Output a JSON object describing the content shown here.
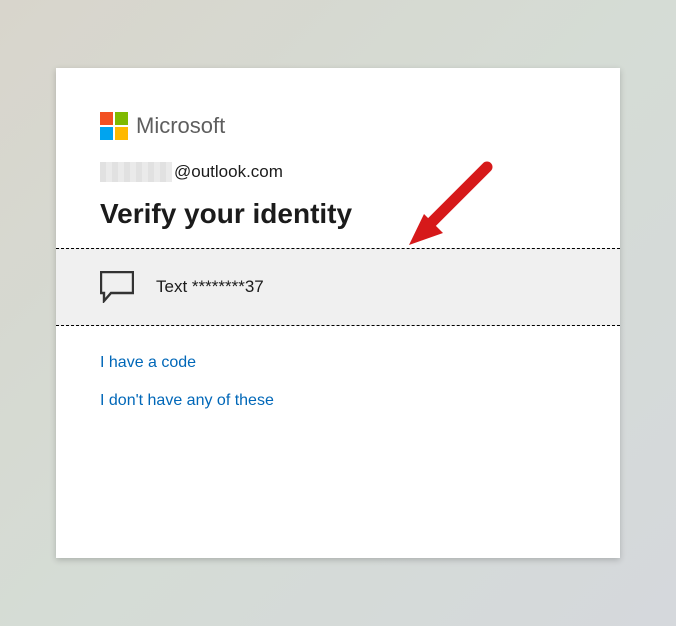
{
  "brand": "Microsoft",
  "account": {
    "username_redacted": true,
    "domain": "@outlook.com"
  },
  "title": "Verify your identity",
  "verification_option": {
    "icon": "text-message-icon",
    "label": "Text ********37"
  },
  "links": {
    "have_code": "I have a code",
    "none_of_these": "I don't have any of these"
  },
  "annotation": {
    "arrow_color": "#d6191a"
  }
}
